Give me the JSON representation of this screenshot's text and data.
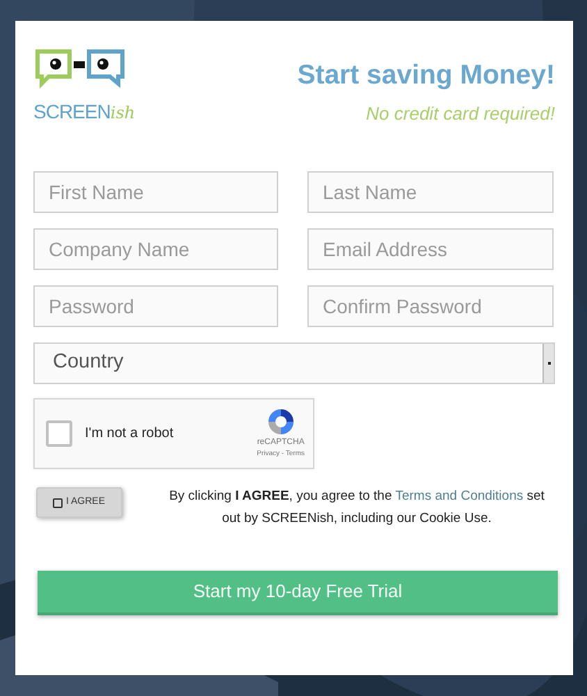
{
  "header": {
    "logo_word": "SCREEN",
    "logo_script": "ish",
    "title": "Start saving Money!",
    "subtitle": "No credit card required!"
  },
  "fields": [
    {
      "placeholder": "First Name"
    },
    {
      "placeholder": "Last Name"
    },
    {
      "placeholder": "Company Name"
    },
    {
      "placeholder": "Email Address"
    },
    {
      "placeholder": "Password"
    },
    {
      "placeholder": "Confirm Password"
    }
  ],
  "country_select": {
    "value": "Country"
  },
  "captcha": {
    "label": "I'm not a robot",
    "checked": false,
    "brand": "reCAPTCHA",
    "links": "Privacy - Terms"
  },
  "agree": {
    "label": "I AGREE",
    "checked": false,
    "text_before": "By clicking **I AGREE**, you agree to the ",
    "link": "Terms and Conditions",
    "text_after": " set out by SCREENish, including our Cookie Use."
  },
  "submit": {
    "label": "Start my 10-day Free Trial"
  }
}
